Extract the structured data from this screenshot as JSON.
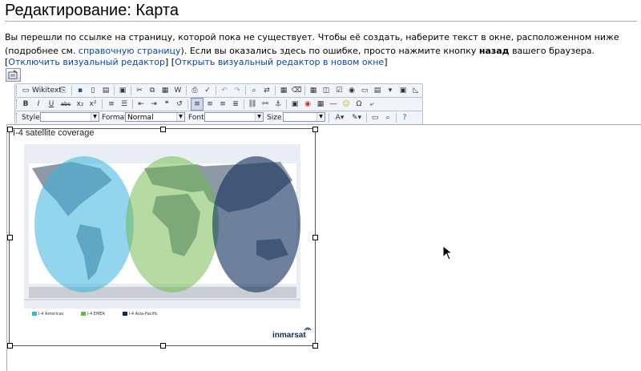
{
  "page": {
    "title": "Редактирование: Карта",
    "intro_1": "Вы перешли по ссылке на страницу, которой пока не существует. Чтобы её создать, наберите текст в окне, расположенном ниже (подробнее см. ",
    "intro_link": "справочную страницу",
    "intro_2": "). Если вы оказались здесь по ошибке, просто нажмите кнопку ",
    "intro_bold": "назад",
    "intro_3": " вашего браузера.",
    "link_disable": "Отключить визуальный редактор",
    "link_new_window": "Открыть визуальный редактор в новом окне"
  },
  "toolbar": {
    "wikitext_label": "Wikitext",
    "style_label": "Style",
    "format_label": "Format",
    "format_value": "Normal",
    "font_label": "Font",
    "size_label": "Size",
    "row2_glyphs": [
      "B",
      "I",
      "U",
      "abc",
      "x₂",
      "x²"
    ],
    "row1_icons": [
      "source-icon",
      "paste-icon",
      "save-icon",
      "new-page-icon",
      "preview-icon",
      "templates-icon",
      "cut-icon",
      "copy-icon",
      "paste-text-icon",
      "paste-word-icon",
      "print-icon",
      "spellcheck-icon",
      "undo-icon",
      "redo-icon",
      "find-icon",
      "replace-icon",
      "select-all-icon",
      "remove-format-icon",
      "table-icon",
      "form-icon",
      "checkbox-icon",
      "radio-icon",
      "textfield-icon",
      "textarea-icon",
      "select-icon",
      "button-icon",
      "image-button-icon",
      "hidden-field-icon"
    ],
    "row3_icons": [
      "text-color-icon",
      "bg-color-icon",
      "maximize-icon",
      "show-blocks-icon",
      "about-icon"
    ]
  },
  "image": {
    "caption": "I-4 satellite coverage",
    "brand": "inmarsat",
    "legend": [
      "I-4 Americas",
      "I-4 EMEA",
      "I-4 Asia-Pacific"
    ],
    "colors": {
      "americas": "#3bb3dd",
      "emea": "#6cb847",
      "asia_pacific": "#0d2c5a"
    }
  }
}
